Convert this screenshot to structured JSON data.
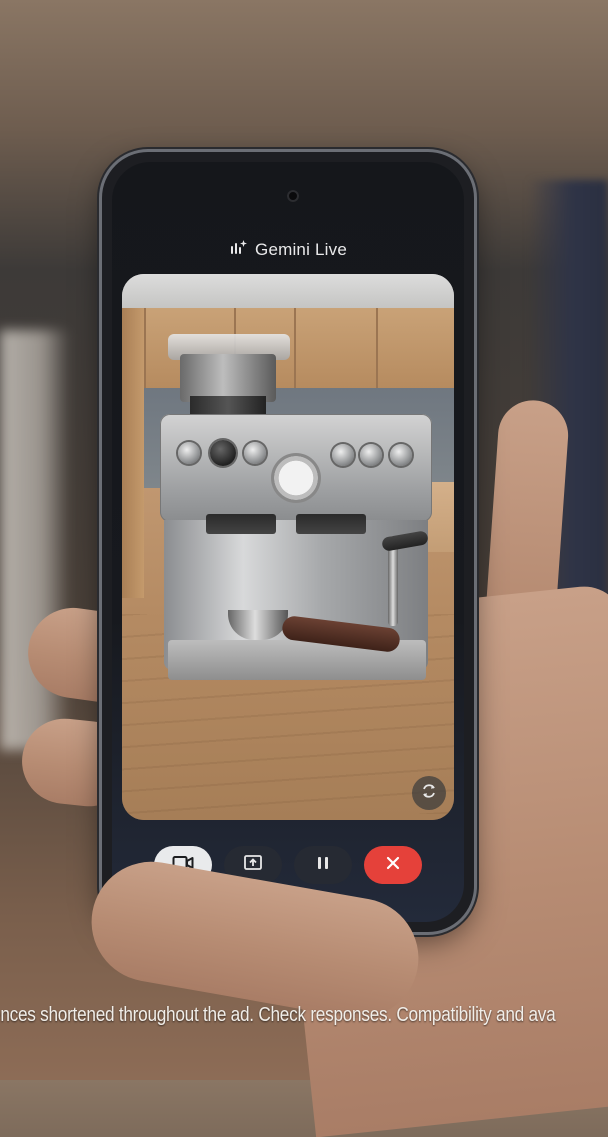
{
  "header": {
    "icon": "gemini-live-sparkle-icon",
    "title": "Gemini Live"
  },
  "camera_view": {
    "flip_button_icon": "switch-camera-icon"
  },
  "controls": [
    {
      "name": "video",
      "icon": "video-camera-icon",
      "active": true,
      "color": "#e9eaec"
    },
    {
      "name": "share-screen",
      "icon": "screen-share-icon",
      "color": "#262a33"
    },
    {
      "name": "pause",
      "icon": "pause-icon",
      "color": "#262a33"
    },
    {
      "name": "end",
      "icon": "close-icon",
      "color": "#e5413a"
    }
  ],
  "caption": {
    "text": "uences shortened throughout the ad. Check responses. Compatibility and ava"
  }
}
